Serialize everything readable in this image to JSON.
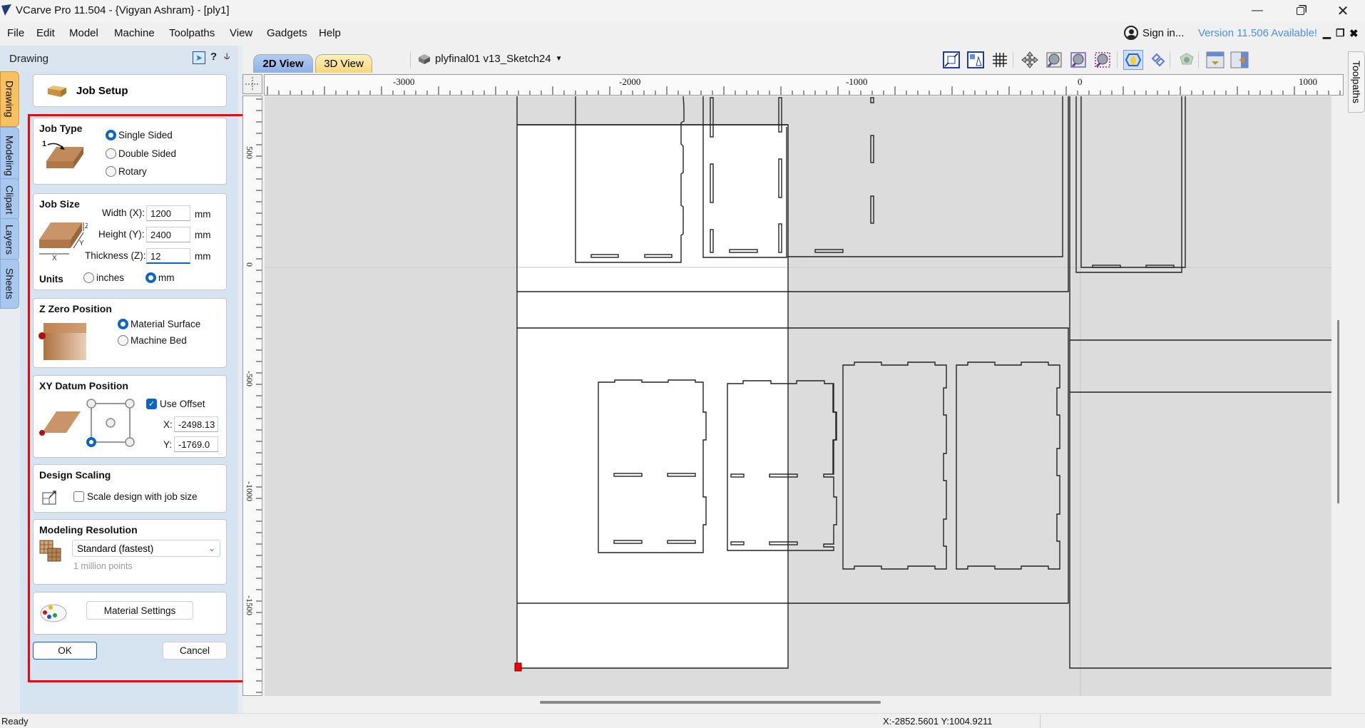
{
  "window": {
    "title": "VCarve Pro 11.504 - {Vigyan Ashram} - [ply1]",
    "controls": [
      "minimize",
      "maximize",
      "close"
    ]
  },
  "menu": {
    "items": [
      "File",
      "Edit",
      "Model",
      "Machine",
      "Toolpaths",
      "View",
      "Gadgets",
      "Help"
    ],
    "sign_in": "Sign in...",
    "update_notice": "Version 11.506 Available!"
  },
  "left_panel": {
    "title": "Drawing",
    "side_tabs": [
      {
        "label": "Drawing",
        "active": true
      },
      {
        "label": "Modeling",
        "active": false
      },
      {
        "label": "Clipart",
        "active": false
      },
      {
        "label": "Layers",
        "active": false
      },
      {
        "label": "Sheets",
        "active": false
      }
    ],
    "header_icons": [
      "dock-arrow-icon",
      "help-icon",
      "pin-icon"
    ],
    "job_setup_title": "Job Setup",
    "job_type": {
      "title": "Job Type",
      "icon_label": "1",
      "options": [
        "Single Sided",
        "Double Sided",
        "Rotary"
      ],
      "selected": "Single Sided"
    },
    "job_size": {
      "title": "Job Size",
      "width_label": "Width (X):",
      "width_value": "1200",
      "width_unit": "mm",
      "height_label": "Height (Y):",
      "height_value": "2400",
      "height_unit": "mm",
      "thickness_label": "Thickness (Z):",
      "thickness_value": "12",
      "thickness_unit": "mm",
      "units_label": "Units",
      "unit_options": [
        "inches",
        "mm"
      ],
      "unit_selected": "mm"
    },
    "z_zero": {
      "title": "Z Zero Position",
      "options": [
        "Material Surface",
        "Machine Bed"
      ],
      "selected": "Material Surface"
    },
    "xy_datum": {
      "title": "XY Datum Position",
      "use_offset_label": "Use Offset",
      "use_offset_checked": true,
      "x_label": "X:",
      "x_value": "-2498.13",
      "y_label": "Y:",
      "y_value": "-1769.0",
      "selected_corner": "bottom-left"
    },
    "design_scaling": {
      "title": "Design Scaling",
      "scale_label": "Scale design with job size",
      "scale_checked": false
    },
    "modeling_resolution": {
      "title": "Modeling Resolution",
      "selected": "Standard (fastest)",
      "hint": "1 million points"
    },
    "material_settings_label": "Material Settings",
    "ok_label": "OK",
    "cancel_label": "Cancel"
  },
  "view": {
    "tabs": [
      {
        "label": "2D View",
        "active": true
      },
      {
        "label": "3D View",
        "active": false
      }
    ],
    "sketch_name": "plyfinal01 v13_Sketch24",
    "toolbar_icons": [
      "set-material-size-icon",
      "snap-icon",
      "grid-icon",
      "pan-icon",
      "zoom-box-icon",
      "zoom-extents-icon",
      "zoom-selection-icon",
      "draw-vectors-icon",
      "show-toolpaths-icon",
      "material-icon",
      "layout-top-icon",
      "layout-side-icon"
    ],
    "h_ruler_labels": [
      "-3000",
      "-2000",
      "-1000",
      "0",
      "1000"
    ],
    "v_ruler_labels": [
      "500",
      "0",
      "-500",
      "-1000",
      "-1500"
    ],
    "right_tab": "Toolpaths"
  },
  "status": {
    "text": "Ready",
    "coords": "X:-2852.5601 Y:1004.9211"
  },
  "colors": {
    "accent": "#0a66c2",
    "highlight_box": "#ff0000",
    "update_link": "#4a90e2",
    "datum_marker": "#ff0000"
  }
}
